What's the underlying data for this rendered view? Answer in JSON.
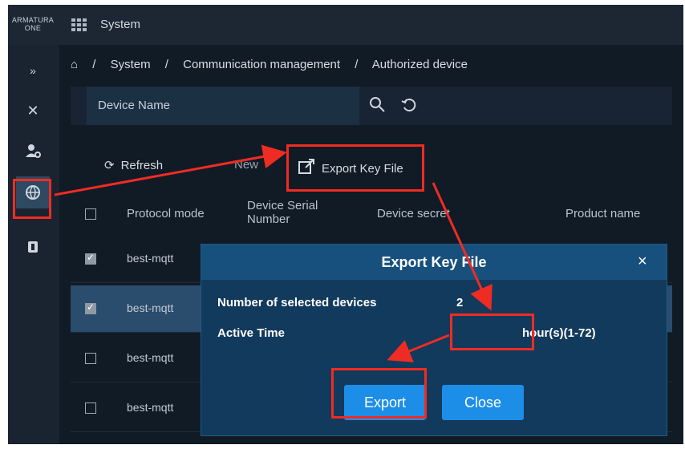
{
  "topbar": {
    "brand_line1": "ARMATURA",
    "brand_line2": "ONE",
    "title": "System"
  },
  "sidebar": {
    "items": [
      "collapse-icon",
      "tools-icon",
      "user-settings-icon",
      "globe-icon",
      "door-icon"
    ]
  },
  "breadcrumb": [
    "System",
    "Communication management",
    "Authorized device"
  ],
  "search": {
    "placeholder": "Device Name"
  },
  "toolbar": {
    "refresh": "Refresh",
    "new": "New",
    "export": "Export Key File"
  },
  "table": {
    "headers": [
      "Protocol mode",
      "Device Serial Number",
      "Device secret",
      "Product name"
    ],
    "rows": [
      {
        "protocol": "best-mqtt",
        "checked": true
      },
      {
        "protocol": "best-mqtt",
        "checked": true
      },
      {
        "protocol": "best-mqtt",
        "checked": false
      },
      {
        "protocol": "best-mqtt",
        "checked": false
      }
    ]
  },
  "dialog": {
    "title": "Export Key File",
    "selected_label": "Number of selected devices",
    "selected_value": "2",
    "active_label": "Active Time",
    "active_value": "",
    "active_hint": "hour(s)(1-72)",
    "export_button": "Export",
    "close_button": "Close"
  },
  "colors": {
    "annotation": "#ef2c23",
    "dialog": "#123a5c",
    "button": "#1d8ee8"
  }
}
